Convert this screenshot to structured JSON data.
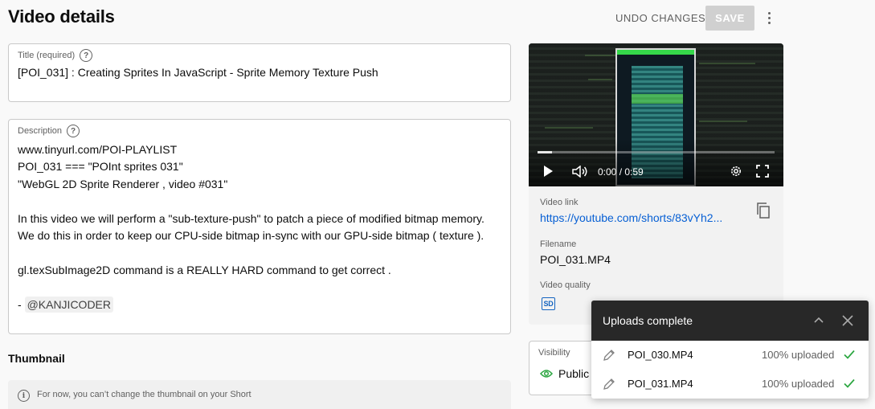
{
  "header": {
    "title": "Video details",
    "undo_label": "UNDO CHANGES",
    "save_label": "SAVE"
  },
  "title_field": {
    "label": "Title (required)",
    "value": "[POI_031] : Creating Sprites In JavaScript - Sprite Memory Texture Push"
  },
  "description_field": {
    "label": "Description",
    "lines": [
      "www.tinyurl.com/POI-PLAYLIST",
      "POI_031 === \"POInt sprites 031\"",
      "\"WebGL 2D Sprite Renderer , video #031\"",
      "",
      "In this video we will perform a \"sub-texture-push\" to patch a piece of modified bitmap memory. We do this in order to keep our CPU-side bitmap in-sync with our GPU-side bitmap ( texture ).",
      "",
      "gl.texSubImage2D command is a REALLY HARD command to get correct .",
      ""
    ],
    "signature_prefix": "- ",
    "mention": "@KANJICODER"
  },
  "thumbnail": {
    "heading": "Thumbnail",
    "note": "For now, you can’t change the thumbnail on your Short"
  },
  "player": {
    "time": "0:00 / 0:59",
    "progress": 0.06
  },
  "video_info": {
    "link_label": "Video link",
    "link": "https://youtube.com/shorts/83vYh2...",
    "filename_label": "Filename",
    "filename": "POI_031.MP4",
    "quality_label": "Video quality",
    "quality_badge": "SD"
  },
  "visibility": {
    "label": "Visibility",
    "value": "Public"
  },
  "uploads": {
    "title": "Uploads complete",
    "items": [
      {
        "file": "POI_030.MP4",
        "status": "100% uploaded"
      },
      {
        "file": "POI_031.MP4",
        "status": "100% uploaded"
      }
    ]
  },
  "colors": {
    "link": "#065fd4",
    "success": "#2ba640",
    "save_disabled": "#d0d0d0",
    "toast_header": "#282828"
  }
}
